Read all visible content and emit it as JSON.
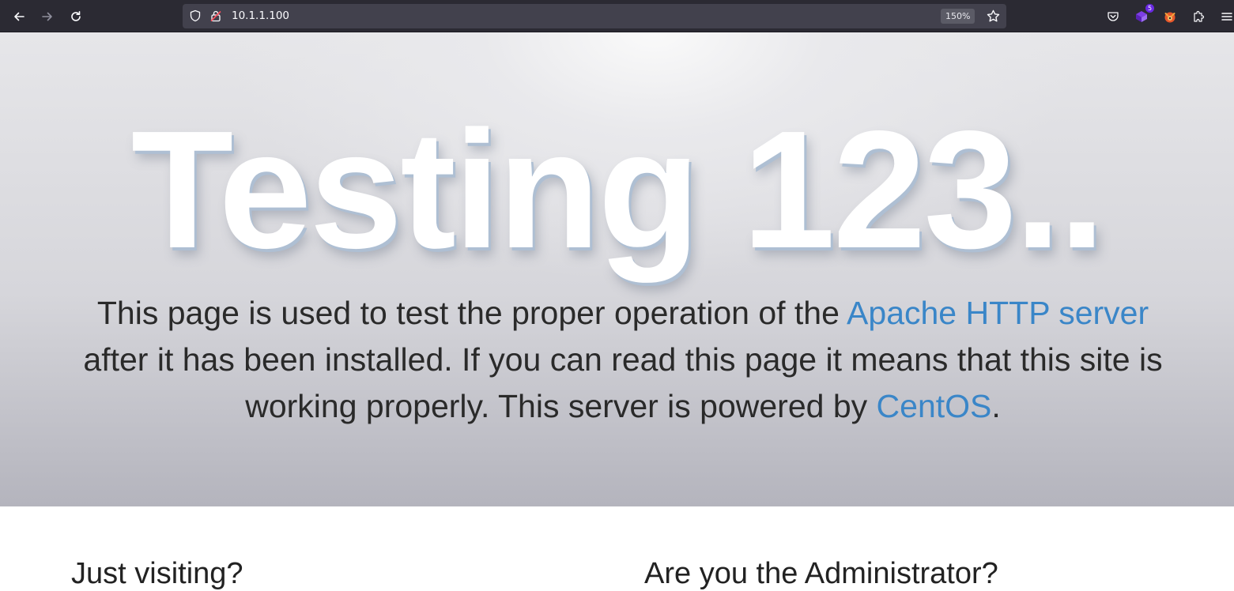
{
  "browser": {
    "url": "10.1.1.100",
    "zoom": "150%",
    "extension_badge_count": "5",
    "icons": [
      "back-icon",
      "forward-icon",
      "reload-icon",
      "shield-icon",
      "insecure-lock-icon",
      "bookmark-star-icon",
      "pocket-icon",
      "extension-icon",
      "extension-fox-icon",
      "extensions-puzzle-icon",
      "menu-icon"
    ]
  },
  "page": {
    "title": "Testing 123..",
    "intro": {
      "part1": "This page is used to test the proper operation of the ",
      "apache_link": "Apache HTTP server",
      "part2": " after it has been installed. If you can read this page it means that this site is working properly. This server is powered by ",
      "centos_link": "CentOS",
      "part3": "."
    },
    "sections": {
      "left_heading": "Just visiting?",
      "right_heading": "Are you the Administrator?"
    },
    "colors": {
      "link": "#3a86c8",
      "title": "#ffffff",
      "text": "#2a2a2a"
    }
  }
}
